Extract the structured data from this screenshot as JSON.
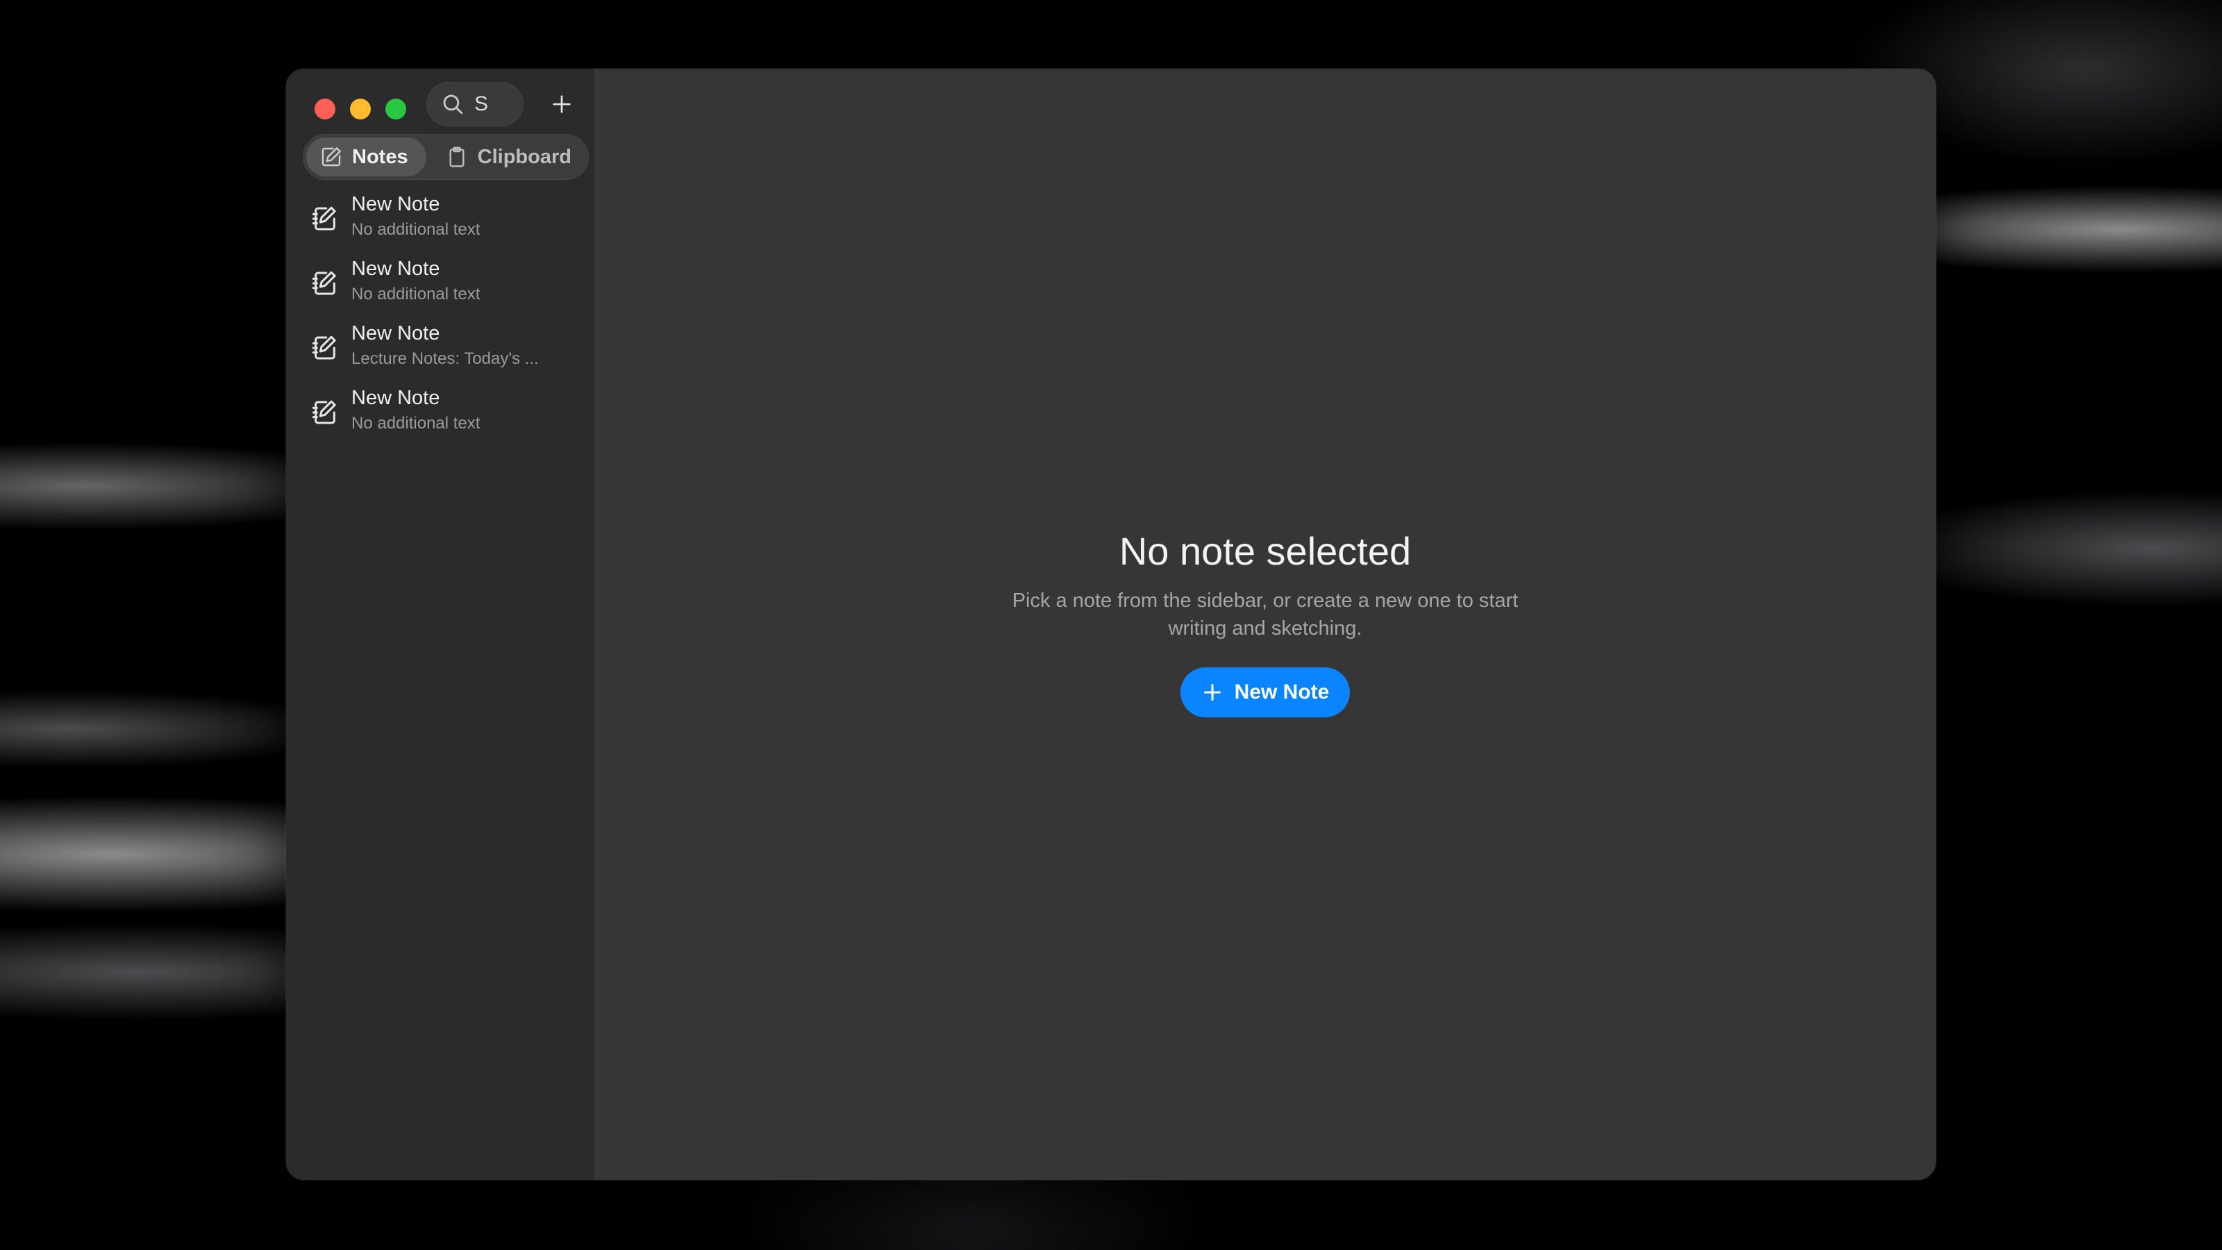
{
  "search": {
    "value": "S"
  },
  "tabs": {
    "notes_label": "Notes",
    "clipboard_label": "Clipboard"
  },
  "notes": [
    {
      "title": "New Note",
      "preview": "No additional text"
    },
    {
      "title": "New Note",
      "preview": "No additional text"
    },
    {
      "title": "New Note",
      "preview": "Lecture Notes: Today's ..."
    },
    {
      "title": "New Note",
      "preview": "No additional text"
    }
  ],
  "empty_state": {
    "title": "No note selected",
    "subtitle": "Pick a note from the sidebar, or create a new one to start writing and sketching.",
    "button_label": "New Note"
  },
  "colors": {
    "accent": "#0a84ff",
    "close": "#fe5f57",
    "minimize": "#febc2e",
    "maximize": "#28c840"
  },
  "icons": [
    "search-icon",
    "plus-icon",
    "note-icon",
    "clipboard-icon"
  ]
}
